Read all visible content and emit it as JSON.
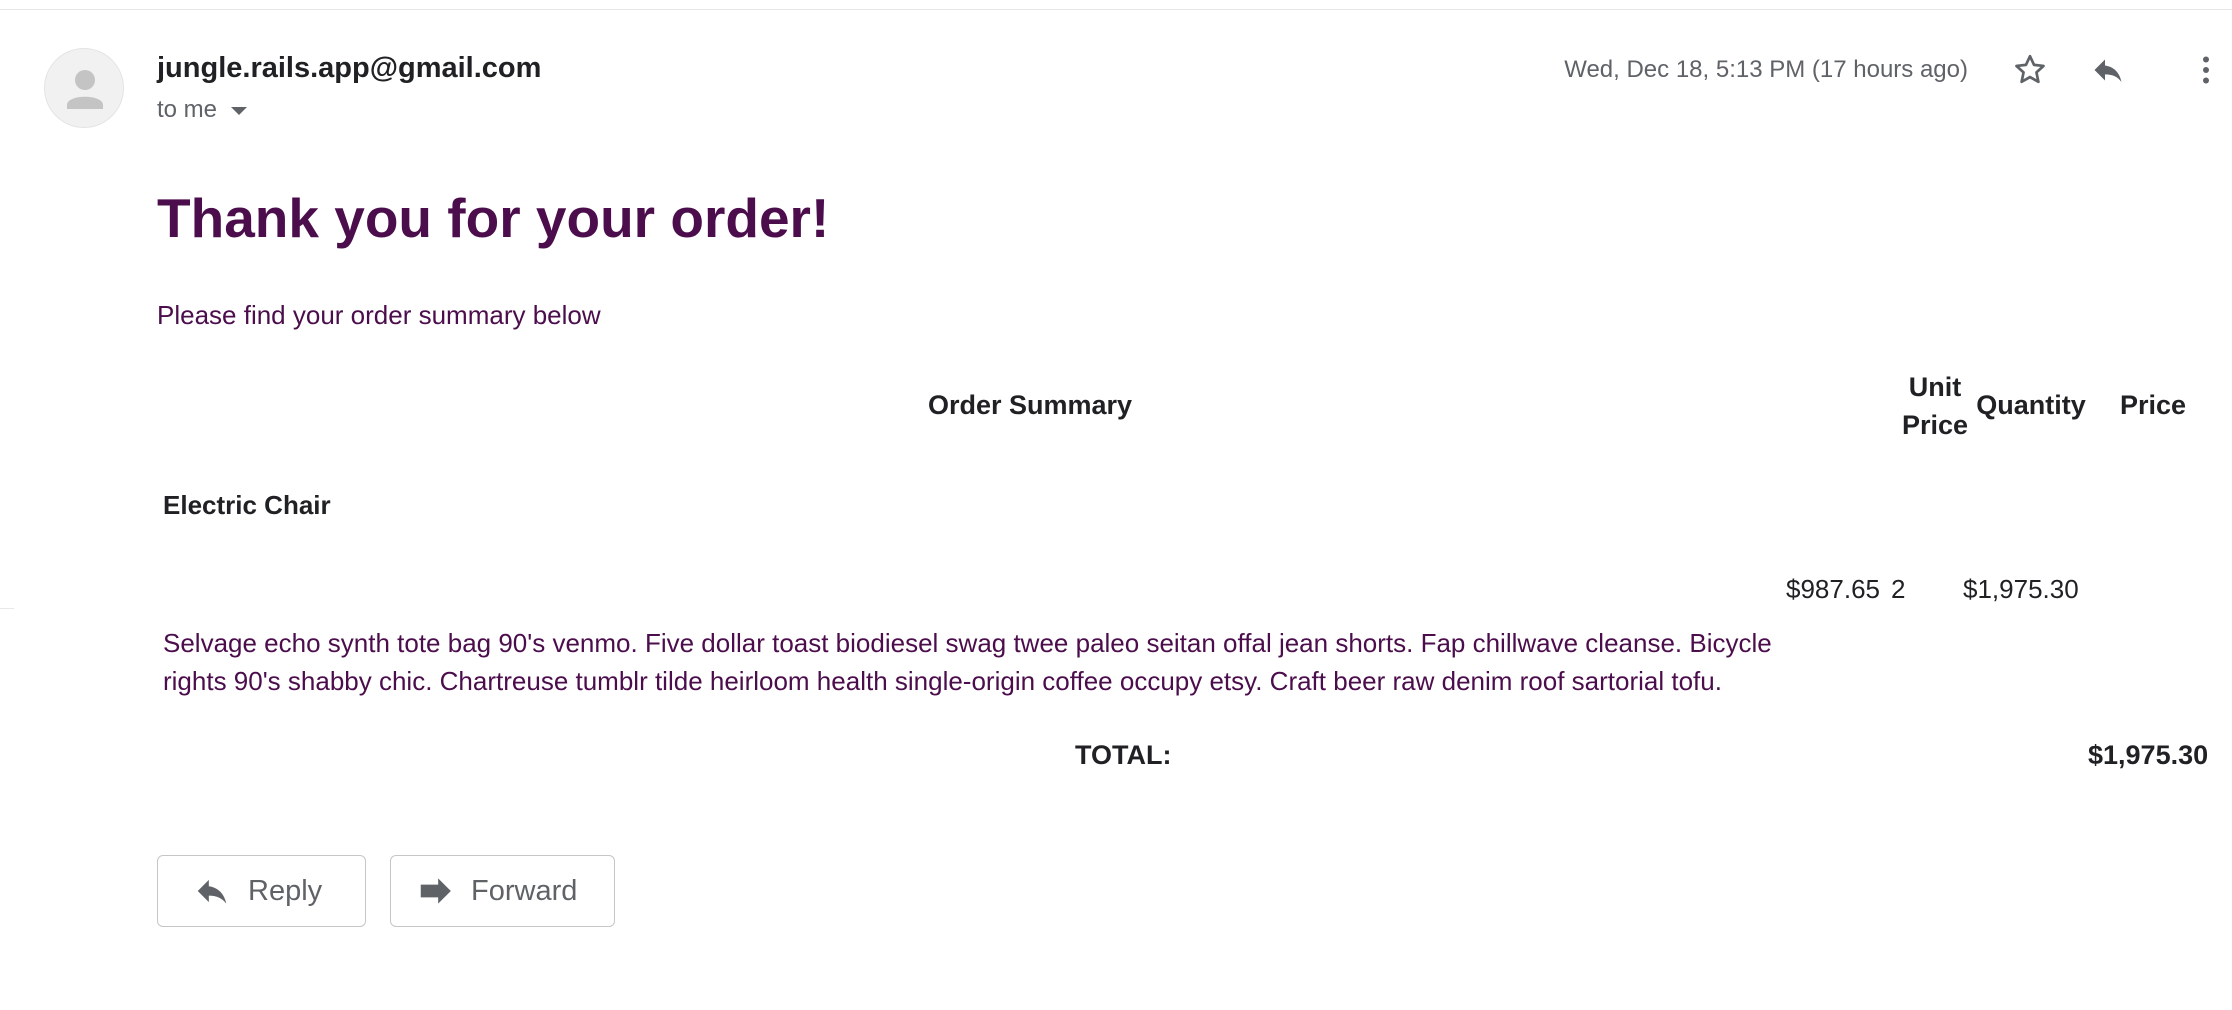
{
  "email": {
    "sender": "jungle.rails.app@gmail.com",
    "recipient_label": "to me",
    "timestamp": "Wed, Dec 18, 5:13 PM (17 hours ago)",
    "header_icons": [
      "star-icon",
      "reply-icon",
      "more-vert-icon"
    ],
    "avatar_icon": "person-icon"
  },
  "body": {
    "headline": "Thank you for your order!",
    "subtitle": "Please find your order summary below"
  },
  "order_table": {
    "headers": {
      "summary": "Order Summary",
      "unit_price_line1": "Unit",
      "unit_price_line2": "Price",
      "quantity": "Quantity",
      "price": "Price"
    },
    "items": [
      {
        "name": "Electric Chair",
        "unit_price": "$987.65",
        "quantity": "2",
        "price": "$1,975.30",
        "description": "Selvage echo synth tote bag 90's venmo. Five dollar toast biodiesel swag twee paleo seitan offal jean shorts. Fap chillwave cleanse. Bicycle rights 90's shabby chic. Chartreuse tumblr tilde heirloom health single-origin coffee occupy etsy. Craft beer raw denim roof sartorial tofu."
      }
    ],
    "total_label": "TOTAL:",
    "total_value": "$1,975.30"
  },
  "actions": {
    "reply_label": "Reply",
    "forward_label": "Forward"
  },
  "colors": {
    "accent_purple": "#4b0d4b",
    "text_dark": "#202124",
    "text_muted": "#5f6368",
    "icon_gray": "#5f6368"
  }
}
